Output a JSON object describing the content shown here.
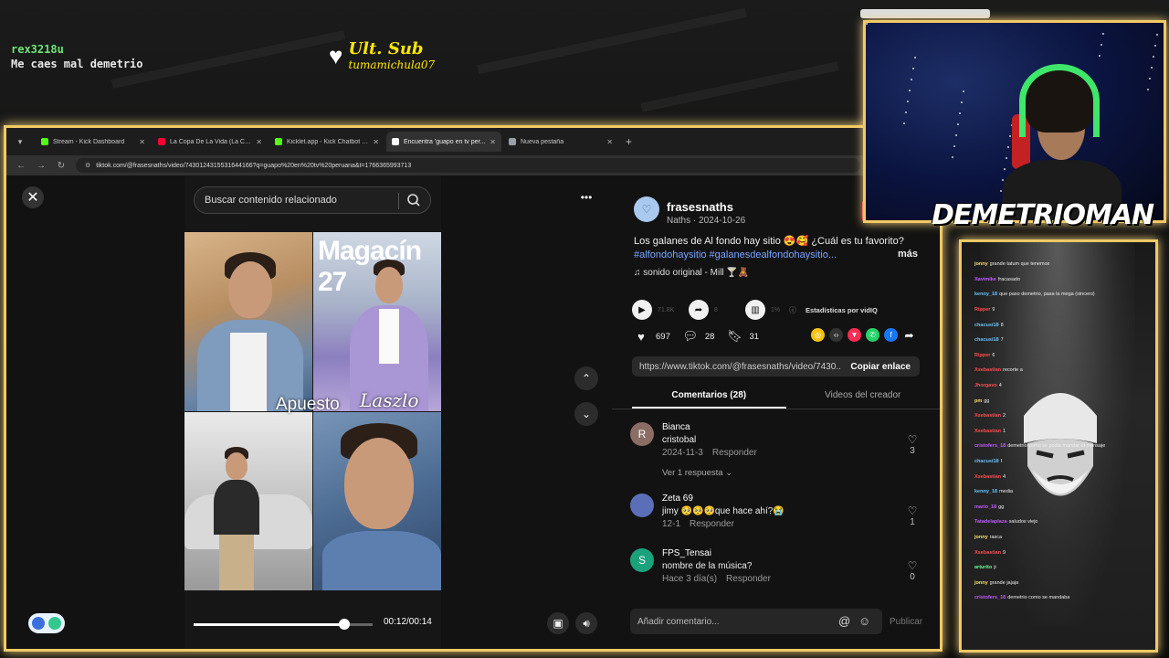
{
  "overlay": {
    "chat_user": "rex3218u",
    "chat_message": "Me caes mal demetrio",
    "sub_title": "Ult. Sub",
    "sub_name": "tumamichula07",
    "brand": "DEMETRIOMAN"
  },
  "browser": {
    "tabs": [
      {
        "title": "Stream - Kick Dashboard",
        "color": "#53fc18",
        "active": false
      },
      {
        "title": "La Copa De La Vida (La Canción...",
        "color": "#ff0033",
        "active": false
      },
      {
        "title": "Kicklet.app - Kick Chatbot and ...",
        "color": "#53fc18",
        "active": false
      },
      {
        "title": "Encuentra 'guapo en tv per...",
        "color": "#ffffff",
        "active": true
      },
      {
        "title": "Nueva pestaña",
        "color": "#9aa0a6",
        "active": false
      }
    ],
    "url": "tiktok.com/@frasesnaths/video/7430124315531644166?q=guapo%20en%20tv%20peruana&t=1766365993713"
  },
  "video": {
    "search_placeholder": "Buscar contenido relacionado",
    "magazine_title": "Magacín 27",
    "caption_a": "Apuesto",
    "caption_b": "Laszlo",
    "time": "00:12/00:14",
    "progress": 0.84
  },
  "post": {
    "username": "frasesnaths",
    "meta": "Naths · 2024-10-26",
    "description": "Los galanes de Al fondo hay sitio 😍🥰 ¿Cuál es tu favorito?",
    "hashtags": "#alfondohaysitio #galanesdealfondohaysitio...",
    "more": "más",
    "sound": "♫ sonido original - Mill 🍸🧸",
    "plays": "71.8K",
    "shares_count": "8",
    "percent": "1%",
    "vidiq": "Estadísticas por vidIQ",
    "likes": "697",
    "comments": "28",
    "saves": "31",
    "link": "https://www.tiktok.com/@frasesnaths/video/7430...",
    "copy_label": "Copiar enlace",
    "tab_comments": "Comentarios (28)",
    "tab_creator": "Videos del creador",
    "add_comment": "Añadir comentario...",
    "publish": "Publicar"
  },
  "comments": [
    {
      "initial": "R",
      "avatar_color": "#8a6d64",
      "name": "Bianca",
      "text": "cristobal",
      "date": "2024-11-3",
      "reply": "Responder",
      "likes": "3",
      "replies": "Ver 1 respuesta"
    },
    {
      "initial": "",
      "avatar_color": "#5b6fb8",
      "name": "Zeta 69",
      "text": "jimy 🥺🥺🥺que hace ahí?😭",
      "date": "12-1",
      "reply": "Responder",
      "likes": "1",
      "replies": ""
    },
    {
      "initial": "S",
      "avatar_color": "#1aa37a",
      "name": "FPS_Tensai",
      "text": "nombre de la música?",
      "date": "Hace 3 día(s)",
      "reply": "Responder",
      "likes": "0",
      "replies": ""
    }
  ],
  "side_chat": [
    {
      "user": "jonny",
      "color": "#ffe066",
      "msg": "grande tatum que tenemos"
    },
    {
      "user": "Xavimike",
      "color": "#c05cff",
      "msg": "fracasado"
    },
    {
      "user": "kenny_18",
      "color": "#66c2ff",
      "msg": "que paso demetrio, pasa la mega (sincero)"
    },
    {
      "user": "Ripper",
      "color": "#ff4d4d",
      "msg": "9"
    },
    {
      "user": "chacusi18",
      "color": "#66c2ff",
      "msg": "8"
    },
    {
      "user": "chacusi18",
      "color": "#66c2ff",
      "msg": "7"
    },
    {
      "user": "Ripper",
      "color": "#ff4d4d",
      "msg": "6"
    },
    {
      "user": "Xsebastian",
      "color": "#ff4d4d",
      "msg": "recorte a"
    },
    {
      "user": "Jhorgavo",
      "color": "#ff4d4d",
      "msg": "4"
    },
    {
      "user": "pm",
      "color": "#ffe066",
      "msg": "gg"
    },
    {
      "user": "Xsebastian",
      "color": "#ff4d4d",
      "msg": "2"
    },
    {
      "user": "Xsebastian",
      "color": "#ff4d4d",
      "msg": "1"
    },
    {
      "user": "cristofers_18",
      "color": "#c05cff",
      "msg": "demetrio como se podia mandar el mensaje"
    },
    {
      "user": "chacusi18",
      "color": "#66c2ff",
      "msg": "f"
    },
    {
      "user": "Xsebastian",
      "color": "#ff4d4d",
      "msg": "4"
    },
    {
      "user": "kenny_18",
      "color": "#66c2ff",
      "msg": "media"
    },
    {
      "user": "mario_18",
      "color": "#c05cff",
      "msg": "gg"
    },
    {
      "user": "Tatadelaplaza",
      "color": "#c05cff",
      "msg": "saludos viejo"
    },
    {
      "user": "jonny",
      "color": "#ffe066",
      "msg": "rasca"
    },
    {
      "user": "Xsebastian",
      "color": "#ff4d4d",
      "msg": "9"
    },
    {
      "user": "arturito",
      "color": "#66ff99",
      "msg": "ji"
    },
    {
      "user": "jonny",
      "color": "#ffe066",
      "msg": "grande jajaja"
    },
    {
      "user": "cristofers_18",
      "color": "#c05cff",
      "msg": "demetrio como se mandaba"
    }
  ]
}
